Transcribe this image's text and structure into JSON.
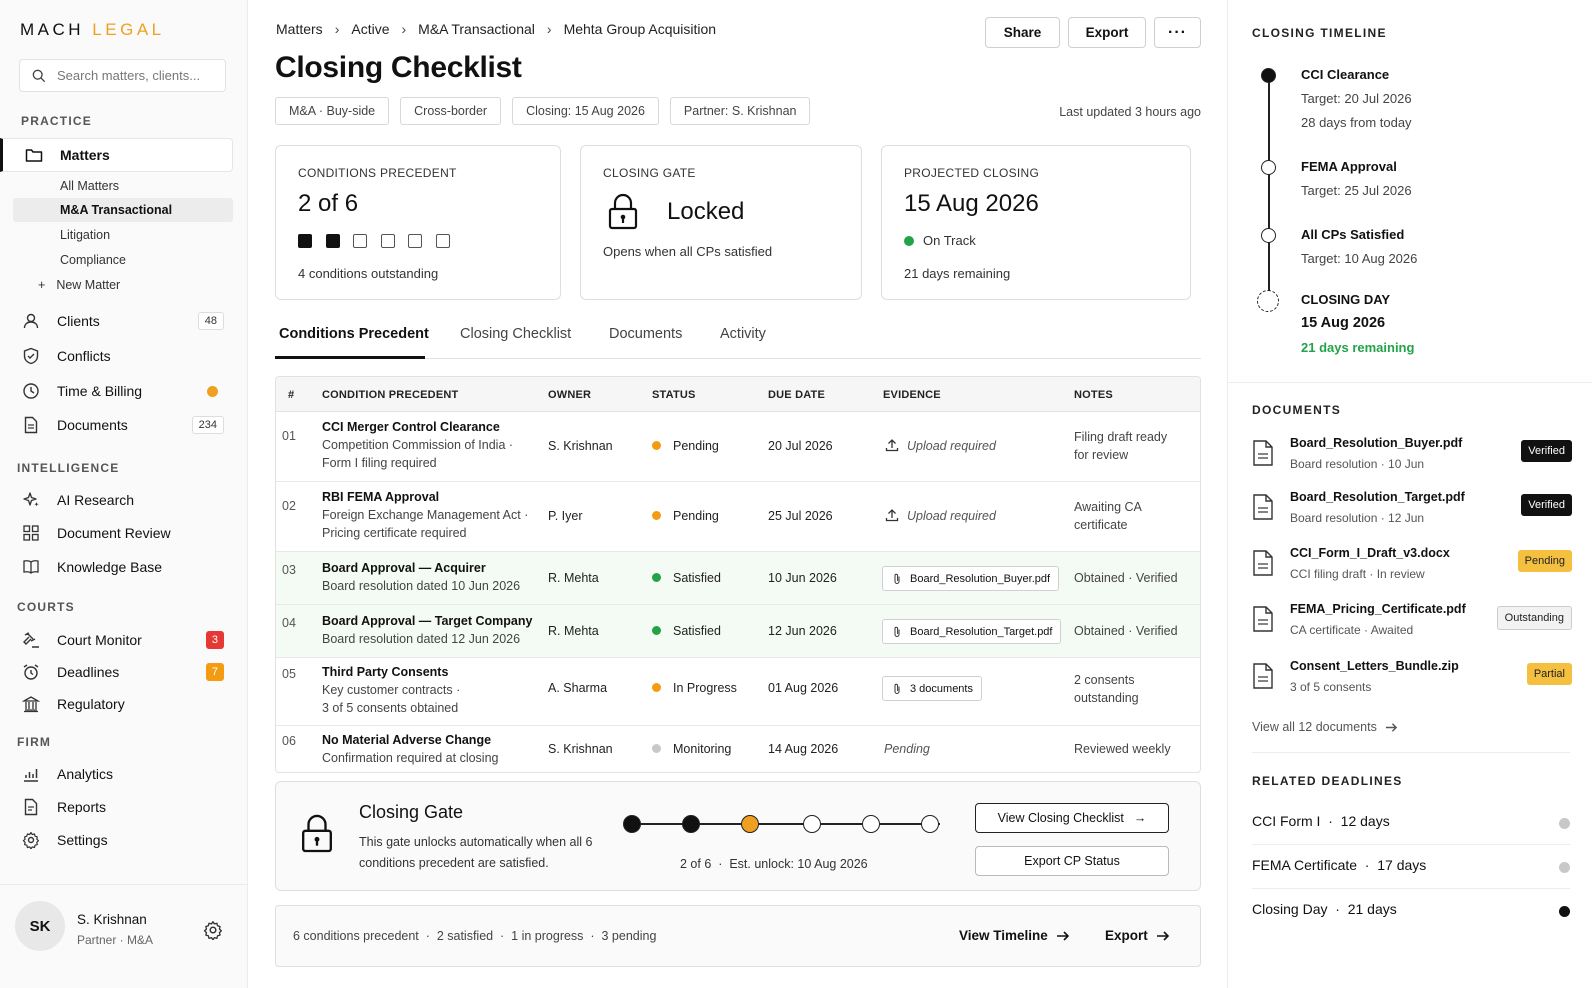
{
  "sidebar": {
    "logo_part1": "MACH",
    "logo_part2": "LEGAL",
    "search_placeholder": "Search matters, clients...",
    "sections": {
      "practice": "PRACTICE",
      "intelligence": "INTELLIGENCE",
      "courts": "COURTS",
      "firm": "FIRM"
    },
    "matters": "Matters",
    "sub_items": [
      "All Matters",
      "M&A Transactional",
      "Litigation",
      "Compliance",
      "New Matter"
    ],
    "clients": {
      "label": "Clients",
      "badge": "48"
    },
    "conflicts": "Conflicts",
    "time_billing": "Time & Billing",
    "documents": {
      "label": "Documents",
      "badge": "234"
    },
    "ai_research": "AI Research",
    "document_review": "Document Review",
    "knowledge_base": "Knowledge Base",
    "court_monitor": {
      "label": "Court Monitor",
      "badge": "3"
    },
    "deadlines": {
      "label": "Deadlines",
      "badge": "7"
    },
    "regulatory": "Regulatory",
    "analytics": "Analytics",
    "reports": "Reports",
    "settings": "Settings",
    "user": {
      "initials": "SK",
      "name": "S. Krishnan",
      "role": "Partner · M&A"
    }
  },
  "header": {
    "breadcrumbs": [
      "Matters",
      "Active",
      "M&A Transactional",
      "Mehta Group Acquisition"
    ],
    "share": "Share",
    "export": "Export",
    "more": "···",
    "title": "Closing Checklist",
    "chips": [
      "M&A · Buy-side",
      "Cross-border",
      "Closing: 15 Aug 2026",
      "Partner: S. Krishnan"
    ],
    "updated": "Last updated 3 hours ago"
  },
  "cards": {
    "cp": {
      "label": "CONDITIONS PRECEDENT",
      "value": "2 of 6",
      "satisfied": 2,
      "total": 6,
      "sub": "4 conditions outstanding"
    },
    "gate": {
      "label": "CLOSING GATE",
      "value": "Locked",
      "sub": "Opens when all CPs satisfied"
    },
    "projected": {
      "label": "PROJECTED CLOSING",
      "value": "15 Aug 2026",
      "status": "On Track",
      "sub": "21 days remaining"
    }
  },
  "tabs": [
    "Conditions Precedent",
    "Closing Checklist",
    "Documents",
    "Activity"
  ],
  "table": {
    "headers": [
      "#",
      "CONDITION PRECEDENT",
      "OWNER",
      "STATUS",
      "DUE DATE",
      "EVIDENCE",
      "NOTES"
    ],
    "rows": [
      {
        "num": "01",
        "title": "CCI Merger Control Clearance",
        "sub1": "Competition Commission of India ·",
        "sub2": "Form I filing required",
        "owner": "S. Krishnan",
        "status": "Pending",
        "due": "20 Jul 2026",
        "evidence": "Upload required",
        "notes1": "Filing draft ready",
        "notes2": "for review"
      },
      {
        "num": "02",
        "title": "RBI FEMA Approval",
        "sub1": "Foreign Exchange Management Act ·",
        "sub2": "Pricing certificate required",
        "owner": "P. Iyer",
        "status": "Pending",
        "due": "25 Jul 2026",
        "evidence": "Upload required",
        "notes1": "Awaiting CA",
        "notes2": "certificate"
      },
      {
        "num": "03",
        "title": "Board Approval — Acquirer",
        "sub1": "Board resolution dated 10 Jun 2026",
        "owner": "R. Mehta",
        "status": "Satisfied",
        "due": "10 Jun 2026",
        "evidence": "Board_Resolution_Buyer.pdf",
        "notes1": "Obtained · Verified"
      },
      {
        "num": "04",
        "title": "Board Approval — Target Company",
        "sub1": "Board resolution dated 12 Jun 2026",
        "owner": "R. Mehta",
        "status": "Satisfied",
        "due": "12 Jun 2026",
        "evidence": "Board_Resolution_Target.pdf",
        "notes1": "Obtained · Verified"
      },
      {
        "num": "05",
        "title": "Third Party Consents",
        "sub1": "Key customer contracts ·",
        "sub2": "3 of 5 consents obtained",
        "owner": "A. Sharma",
        "status": "In Progress",
        "due": "01 Aug 2026",
        "evidence": "3 documents",
        "notes1": "2 consents",
        "notes2": "outstanding"
      },
      {
        "num": "06",
        "title": "No Material Adverse Change",
        "sub1": "Confirmation required at closing",
        "owner": "S. Krishnan",
        "status": "Monitoring",
        "due": "14 Aug 2026",
        "evidence": "Pending",
        "notes1": "Reviewed weekly"
      }
    ]
  },
  "gate_panel": {
    "title": "Closing Gate",
    "desc": "This gate unlocks automatically when all 6 conditions precedent are satisfied.",
    "progress": "2 of 6  ·  Est. unlock: 10 Aug 2026",
    "view_btn": "View Closing Checklist",
    "export_btn": "Export CP Status"
  },
  "footer": {
    "stats": "6 conditions precedent  ·  2 satisfied  ·  1 in progress  ·  3 pending",
    "view_timeline": "View Timeline",
    "export": "Export"
  },
  "timeline": {
    "label": "CLOSING TIMELINE",
    "items": [
      {
        "title": "CCI Clearance",
        "target": "Target: 20 Jul 2026",
        "extra": "28 days from today"
      },
      {
        "title": "FEMA Approval",
        "target": "Target: 25 Jul 2026"
      },
      {
        "title": "All CPs Satisfied",
        "target": "Target: 10 Aug 2026"
      },
      {
        "title": "CLOSING DAY",
        "target": "15 Aug 2026",
        "extra": "21 days remaining"
      }
    ]
  },
  "documents": {
    "label": "DOCUMENTS",
    "items": [
      {
        "name": "Board_Resolution_Buyer.pdf",
        "meta": "Board resolution · 10 Jun",
        "badge": "Verified"
      },
      {
        "name": "Board_Resolution_Target.pdf",
        "meta": "Board resolution · 12 Jun",
        "badge": "Verified"
      },
      {
        "name": "CCI_Form_I_Draft_v3.docx",
        "meta": "CCI filing draft · In review",
        "badge": "Pending"
      },
      {
        "name": "FEMA_Pricing_Certificate.pdf",
        "meta": "CA certificate · Awaited",
        "badge": "Outstanding"
      },
      {
        "name": "Consent_Letters_Bundle.zip",
        "meta": "3 of 5 consents",
        "badge": "Partial"
      }
    ],
    "view_all": "View all 12 documents"
  },
  "related": {
    "label": "RELATED DEADLINES",
    "items": [
      "CCI Form I  ·  12 days",
      "FEMA Certificate  ·  17 days",
      "Closing Day  ·  21 days"
    ]
  },
  "colors": {
    "accent": "#f0a020",
    "green": "#22a34a",
    "pending": "#f39c12",
    "grey": "#c8c8c8"
  }
}
